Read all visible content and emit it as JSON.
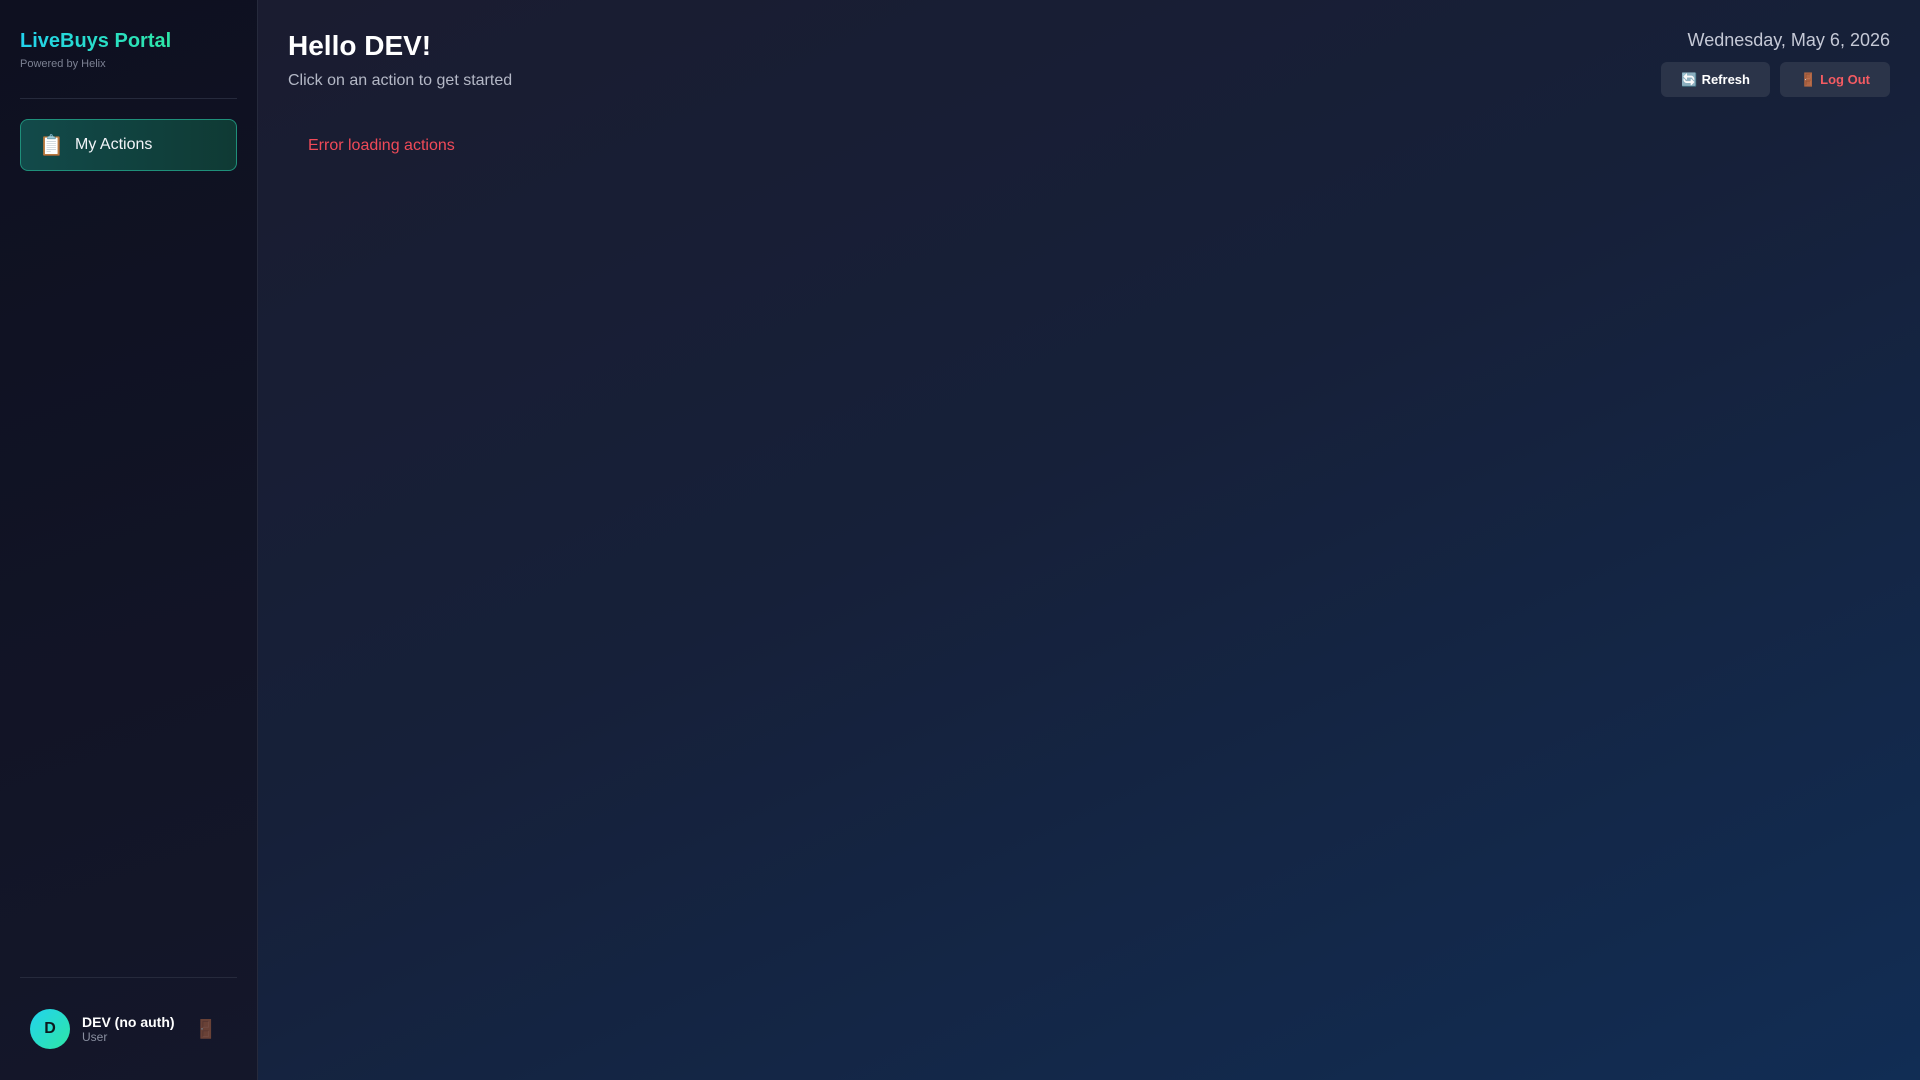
{
  "sidebar": {
    "brand_title": "LiveBuys Portal",
    "brand_subtitle": "Powered by Helix",
    "nav_items": [
      {
        "label": "My Actions",
        "icon": "clipboard-icon",
        "glyph": "📋"
      }
    ],
    "user": {
      "initial": "D",
      "name": "DEV (no auth)",
      "role": "User",
      "logout_glyph": "🚪"
    }
  },
  "header": {
    "greeting": "Hello DEV!",
    "subtitle": "Click on an action to get started",
    "date": "Wednesday, May 6, 2026",
    "refresh_glyph": "🔄",
    "refresh_label": "Refresh",
    "logout_glyph": "🚪",
    "logout_label": "Log Out"
  },
  "content": {
    "error_message": "Error loading actions"
  },
  "colors": {
    "accent": "#2ee6a6",
    "error": "#f04a58"
  }
}
